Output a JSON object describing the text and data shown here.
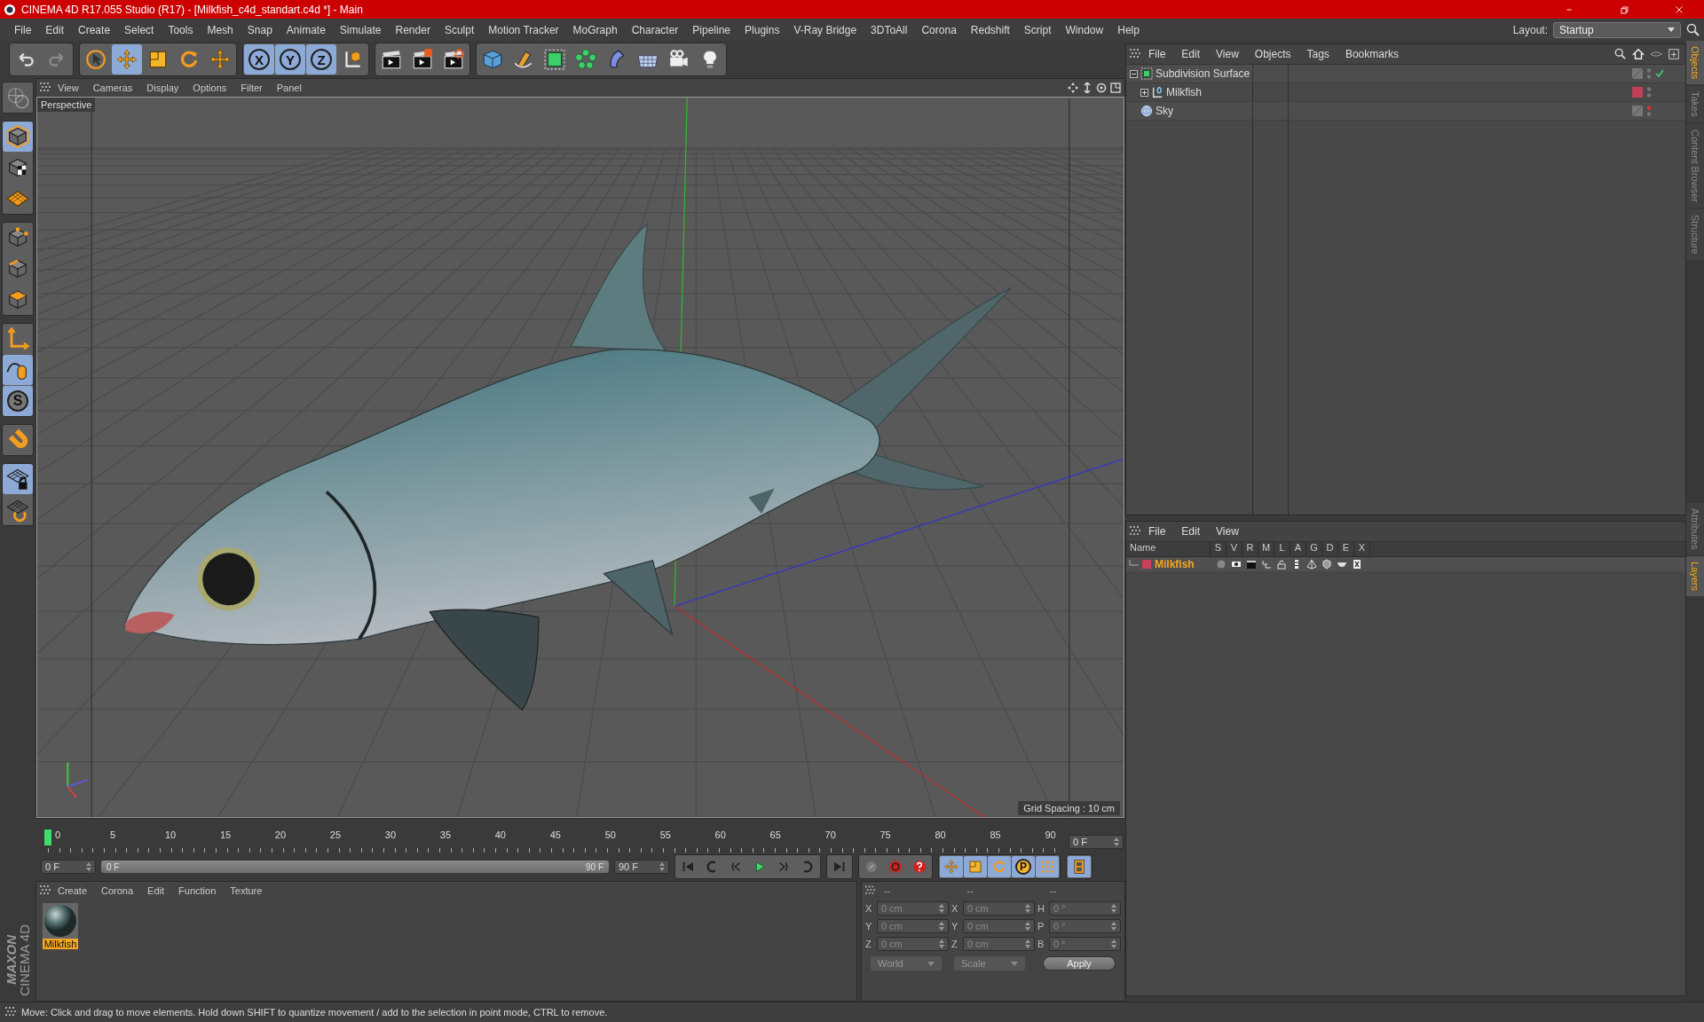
{
  "window": {
    "title": "CINEMA 4D R17.055 Studio (R17) - [Milkfish_c4d_standart.c4d *] - Main"
  },
  "menu_bar": [
    "File",
    "Edit",
    "Create",
    "Select",
    "Tools",
    "Mesh",
    "Snap",
    "Animate",
    "Simulate",
    "Render",
    "Sculpt",
    "Motion Tracker",
    "MoGraph",
    "Character",
    "Pipeline",
    "Plugins",
    "V-Ray Bridge",
    "3DToAll",
    "Corona",
    "Redshift",
    "Script",
    "Window",
    "Help"
  ],
  "layout": {
    "label": "Layout:",
    "value": "Startup"
  },
  "toolbar": [
    {
      "tools": [
        {
          "kind": "undo",
          "selected": false,
          "disabled": false
        },
        {
          "kind": "redo",
          "selected": false,
          "disabled": true
        }
      ]
    },
    {
      "tools": [
        {
          "kind": "select",
          "selected": false,
          "disabled": false
        },
        {
          "kind": "move",
          "selected": true,
          "disabled": false
        },
        {
          "kind": "scale",
          "selected": false,
          "disabled": false
        },
        {
          "kind": "rotate",
          "selected": false,
          "disabled": false
        },
        {
          "kind": "multi",
          "selected": false,
          "disabled": false
        }
      ]
    },
    {
      "tools": [
        {
          "kind": "axis-lock",
          "label": "X",
          "selected": true,
          "disabled": false
        },
        {
          "kind": "axis-lock",
          "label": "Y",
          "selected": true,
          "disabled": false
        },
        {
          "kind": "axis-lock",
          "label": "Z",
          "selected": true,
          "disabled": false
        },
        {
          "kind": "coord-system",
          "selected": false,
          "disabled": false
        }
      ]
    },
    {
      "tools": [
        {
          "kind": "render-view",
          "selected": false,
          "disabled": false
        },
        {
          "kind": "render",
          "selected": false,
          "disabled": false
        },
        {
          "kind": "render-settings",
          "selected": false,
          "disabled": false
        }
      ]
    },
    {
      "tools": [
        {
          "kind": "cube",
          "selected": false,
          "disabled": false
        },
        {
          "kind": "pen",
          "selected": false,
          "disabled": false
        },
        {
          "kind": "subdivision",
          "selected": false,
          "disabled": false
        },
        {
          "kind": "cloner",
          "selected": false,
          "disabled": false
        },
        {
          "kind": "deformer",
          "selected": false,
          "disabled": false
        },
        {
          "kind": "floor",
          "selected": false,
          "disabled": false
        },
        {
          "kind": "camera",
          "selected": false,
          "disabled": false
        },
        {
          "kind": "light",
          "selected": false,
          "disabled": false
        }
      ]
    }
  ],
  "left_toolbar": [
    {
      "tools": [
        {
          "kind": "sculpt",
          "selected": false
        }
      ]
    },
    {
      "tools": [
        {
          "kind": "model",
          "selected": true
        },
        {
          "kind": "texture",
          "selected": false
        },
        {
          "kind": "workplane",
          "selected": false
        }
      ]
    },
    {
      "tools": [
        {
          "kind": "points",
          "selected": false
        },
        {
          "kind": "edges",
          "selected": false
        },
        {
          "kind": "polygons",
          "selected": false
        }
      ]
    },
    {
      "tools": [
        {
          "kind": "axis",
          "selected": false
        },
        {
          "kind": "tweak",
          "selected": true
        },
        {
          "kind": "snap",
          "label": "S",
          "selected": true
        }
      ]
    },
    {
      "tools": [
        {
          "kind": "magnet",
          "selected": false
        }
      ]
    },
    {
      "tools": [
        {
          "kind": "grid-lock",
          "selected": true
        },
        {
          "kind": "grid-rotate",
          "selected": false
        }
      ]
    }
  ],
  "logo": {
    "brand": "MAXON",
    "product": "CINEMA 4D"
  },
  "viewport": {
    "menu": [
      "View",
      "Cameras",
      "Display",
      "Options",
      "Filter",
      "Panel"
    ],
    "camera": "Perspective",
    "grid_spacing": "Grid Spacing : 10 cm"
  },
  "timeline": {
    "labels": [
      "0",
      "5",
      "10",
      "15",
      "20",
      "25",
      "30",
      "35",
      "40",
      "45",
      "50",
      "55",
      "60",
      "65",
      "70",
      "75",
      "80",
      "85",
      "90"
    ],
    "playhead": {
      "level": 0
    },
    "current_frame": "0 F"
  },
  "transport": {
    "start": "0 F",
    "range_start": "0 F",
    "range_end": "90 F",
    "end": "90 F",
    "range": {
      "level": 1
    },
    "groups": [
      {
        "buttons": [
          {
            "kind": "start",
            "selected": false
          },
          {
            "kind": "prev-key",
            "selected": false
          },
          {
            "kind": "prev-frame",
            "selected": false
          },
          {
            "kind": "play",
            "selected": false
          },
          {
            "kind": "next-frame",
            "selected": false
          },
          {
            "kind": "next-key",
            "selected": false
          }
        ]
      },
      {
        "buttons": [
          {
            "kind": "end",
            "selected": false
          }
        ]
      },
      {
        "buttons": [
          {
            "kind": "record",
            "selected": false
          },
          {
            "kind": "autokey",
            "selected": false
          },
          {
            "kind": "keysel",
            "selected": false
          }
        ]
      },
      {
        "buttons": [
          {
            "kind": "key-move",
            "selected": true
          },
          {
            "kind": "key-scale",
            "selected": true
          },
          {
            "kind": "key-rotate",
            "selected": true
          },
          {
            "kind": "key-param",
            "label": "P",
            "selected": true
          },
          {
            "kind": "key-points",
            "selected": true
          }
        ]
      },
      {
        "buttons": [
          {
            "kind": "film",
            "selected": true
          }
        ]
      }
    ]
  },
  "material_manager": {
    "menu": [
      "Create",
      "Corona",
      "Edit",
      "Function",
      "Texture"
    ],
    "materials": [
      {
        "name": "Milkfish",
        "selected": true
      }
    ]
  },
  "coordinates": {
    "headers": [
      "--",
      "--",
      "--"
    ],
    "rows": [
      {
        "label_1": "X",
        "value_1": "0 cm",
        "label_2": "X",
        "value_2": "0 cm",
        "label_3": "H",
        "value_3": "0 °"
      },
      {
        "label_1": "Y",
        "value_1": "0 cm",
        "label_2": "Y",
        "value_2": "0 cm",
        "label_3": "P",
        "value_3": "0 °"
      },
      {
        "label_1": "Z",
        "value_1": "0 cm",
        "label_2": "Z",
        "value_2": "0 cm",
        "label_3": "B",
        "value_3": "0 °"
      }
    ],
    "dropdowns": [
      "World",
      "Scale"
    ],
    "apply": "Apply"
  },
  "object_manager": {
    "menu": [
      "File",
      "Edit",
      "View",
      "Objects",
      "Tags",
      "Bookmarks"
    ],
    "objects": [
      {
        "name": "Subdivision Surface",
        "kind": "subdivision",
        "expanded": true,
        "enabled": true,
        "hidden_in_editor": false,
        "children": [
          {
            "name": "Milkfish",
            "kind": "null",
            "expanded": false,
            "enabled": false,
            "hidden_in_editor": false,
            "color": "#c0405a"
          }
        ]
      },
      {
        "name": "Sky",
        "kind": "sky",
        "enabled": false,
        "hidden_in_editor": true
      }
    ]
  },
  "layer_manager": {
    "menu": [
      "File",
      "Edit",
      "View"
    ],
    "columns": [
      "Name",
      "S",
      "V",
      "R",
      "M",
      "L",
      "A",
      "G",
      "D",
      "E",
      "X"
    ],
    "layers": [
      {
        "name": "Milkfish",
        "color": "#c8405a",
        "selected": true
      }
    ]
  },
  "side_tabs_top": [
    {
      "label": "Objects",
      "selected": true
    },
    {
      "label": "Takes",
      "selected": false
    },
    {
      "label": "Content Browser",
      "selected": false
    },
    {
      "label": "Structure",
      "selected": false
    }
  ],
  "side_tabs_bottom": [
    {
      "label": "Attributes",
      "selected": false
    },
    {
      "label": "Layers",
      "selected": true
    }
  ],
  "status_bar": "Move: Click and drag to move elements. Hold down SHIFT to quantize movement / add to the selection in point mode, CTRL to remove."
}
